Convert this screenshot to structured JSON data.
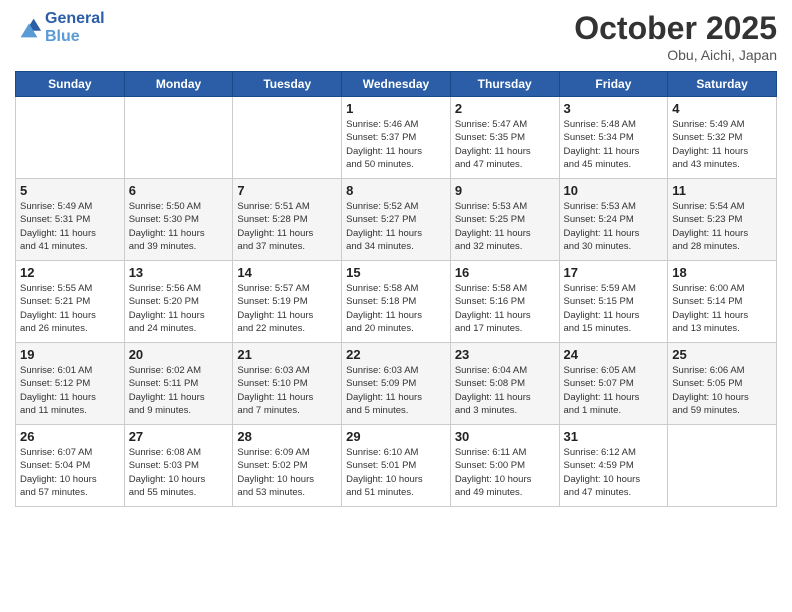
{
  "header": {
    "logo_line1": "General",
    "logo_line2": "Blue",
    "month_title": "October 2025",
    "location": "Obu, Aichi, Japan"
  },
  "weekdays": [
    "Sunday",
    "Monday",
    "Tuesday",
    "Wednesday",
    "Thursday",
    "Friday",
    "Saturday"
  ],
  "weeks": [
    [
      {
        "day": "",
        "info": ""
      },
      {
        "day": "",
        "info": ""
      },
      {
        "day": "",
        "info": ""
      },
      {
        "day": "1",
        "info": "Sunrise: 5:46 AM\nSunset: 5:37 PM\nDaylight: 11 hours\nand 50 minutes."
      },
      {
        "day": "2",
        "info": "Sunrise: 5:47 AM\nSunset: 5:35 PM\nDaylight: 11 hours\nand 47 minutes."
      },
      {
        "day": "3",
        "info": "Sunrise: 5:48 AM\nSunset: 5:34 PM\nDaylight: 11 hours\nand 45 minutes."
      },
      {
        "day": "4",
        "info": "Sunrise: 5:49 AM\nSunset: 5:32 PM\nDaylight: 11 hours\nand 43 minutes."
      }
    ],
    [
      {
        "day": "5",
        "info": "Sunrise: 5:49 AM\nSunset: 5:31 PM\nDaylight: 11 hours\nand 41 minutes."
      },
      {
        "day": "6",
        "info": "Sunrise: 5:50 AM\nSunset: 5:30 PM\nDaylight: 11 hours\nand 39 minutes."
      },
      {
        "day": "7",
        "info": "Sunrise: 5:51 AM\nSunset: 5:28 PM\nDaylight: 11 hours\nand 37 minutes."
      },
      {
        "day": "8",
        "info": "Sunrise: 5:52 AM\nSunset: 5:27 PM\nDaylight: 11 hours\nand 34 minutes."
      },
      {
        "day": "9",
        "info": "Sunrise: 5:53 AM\nSunset: 5:25 PM\nDaylight: 11 hours\nand 32 minutes."
      },
      {
        "day": "10",
        "info": "Sunrise: 5:53 AM\nSunset: 5:24 PM\nDaylight: 11 hours\nand 30 minutes."
      },
      {
        "day": "11",
        "info": "Sunrise: 5:54 AM\nSunset: 5:23 PM\nDaylight: 11 hours\nand 28 minutes."
      }
    ],
    [
      {
        "day": "12",
        "info": "Sunrise: 5:55 AM\nSunset: 5:21 PM\nDaylight: 11 hours\nand 26 minutes."
      },
      {
        "day": "13",
        "info": "Sunrise: 5:56 AM\nSunset: 5:20 PM\nDaylight: 11 hours\nand 24 minutes."
      },
      {
        "day": "14",
        "info": "Sunrise: 5:57 AM\nSunset: 5:19 PM\nDaylight: 11 hours\nand 22 minutes."
      },
      {
        "day": "15",
        "info": "Sunrise: 5:58 AM\nSunset: 5:18 PM\nDaylight: 11 hours\nand 20 minutes."
      },
      {
        "day": "16",
        "info": "Sunrise: 5:58 AM\nSunset: 5:16 PM\nDaylight: 11 hours\nand 17 minutes."
      },
      {
        "day": "17",
        "info": "Sunrise: 5:59 AM\nSunset: 5:15 PM\nDaylight: 11 hours\nand 15 minutes."
      },
      {
        "day": "18",
        "info": "Sunrise: 6:00 AM\nSunset: 5:14 PM\nDaylight: 11 hours\nand 13 minutes."
      }
    ],
    [
      {
        "day": "19",
        "info": "Sunrise: 6:01 AM\nSunset: 5:12 PM\nDaylight: 11 hours\nand 11 minutes."
      },
      {
        "day": "20",
        "info": "Sunrise: 6:02 AM\nSunset: 5:11 PM\nDaylight: 11 hours\nand 9 minutes."
      },
      {
        "day": "21",
        "info": "Sunrise: 6:03 AM\nSunset: 5:10 PM\nDaylight: 11 hours\nand 7 minutes."
      },
      {
        "day": "22",
        "info": "Sunrise: 6:03 AM\nSunset: 5:09 PM\nDaylight: 11 hours\nand 5 minutes."
      },
      {
        "day": "23",
        "info": "Sunrise: 6:04 AM\nSunset: 5:08 PM\nDaylight: 11 hours\nand 3 minutes."
      },
      {
        "day": "24",
        "info": "Sunrise: 6:05 AM\nSunset: 5:07 PM\nDaylight: 11 hours\nand 1 minute."
      },
      {
        "day": "25",
        "info": "Sunrise: 6:06 AM\nSunset: 5:05 PM\nDaylight: 10 hours\nand 59 minutes."
      }
    ],
    [
      {
        "day": "26",
        "info": "Sunrise: 6:07 AM\nSunset: 5:04 PM\nDaylight: 10 hours\nand 57 minutes."
      },
      {
        "day": "27",
        "info": "Sunrise: 6:08 AM\nSunset: 5:03 PM\nDaylight: 10 hours\nand 55 minutes."
      },
      {
        "day": "28",
        "info": "Sunrise: 6:09 AM\nSunset: 5:02 PM\nDaylight: 10 hours\nand 53 minutes."
      },
      {
        "day": "29",
        "info": "Sunrise: 6:10 AM\nSunset: 5:01 PM\nDaylight: 10 hours\nand 51 minutes."
      },
      {
        "day": "30",
        "info": "Sunrise: 6:11 AM\nSunset: 5:00 PM\nDaylight: 10 hours\nand 49 minutes."
      },
      {
        "day": "31",
        "info": "Sunrise: 6:12 AM\nSunset: 4:59 PM\nDaylight: 10 hours\nand 47 minutes."
      },
      {
        "day": "",
        "info": ""
      }
    ]
  ]
}
